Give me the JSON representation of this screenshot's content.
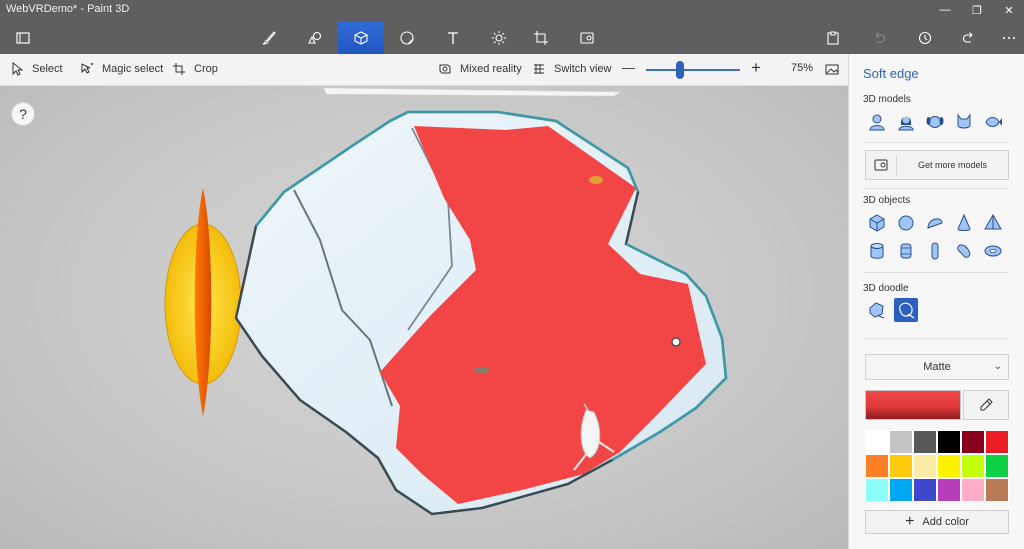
{
  "window": {
    "title": "WebVRDemo* - Paint 3D",
    "controls": [
      "—",
      "❐",
      "✕"
    ]
  },
  "toolbar": {
    "tools": [
      {
        "name": "menu",
        "icon": "folder-icon"
      },
      {
        "name": "brushes",
        "icon": "brush-icon"
      },
      {
        "name": "2d-shapes",
        "icon": "shapes-2d-icon"
      },
      {
        "name": "3d-shapes",
        "icon": "cube-icon",
        "active": true
      },
      {
        "name": "stickers",
        "icon": "sticker-icon"
      },
      {
        "name": "text",
        "icon": "text-icon"
      },
      {
        "name": "effects",
        "icon": "sun-icon"
      },
      {
        "name": "canvas",
        "icon": "canvas-crop-icon"
      },
      {
        "name": "remix3d",
        "icon": "remix-icon"
      }
    ],
    "right": [
      "paste-icon",
      "undo-icon",
      "history-icon",
      "redo-icon",
      "more-icon"
    ]
  },
  "subbar": {
    "select": "Select",
    "magic_select": "Magic select",
    "crop": "Crop",
    "mixed_reality": "Mixed reality",
    "switch_view": "Switch view",
    "zoom_minus": "—",
    "zoom_plus": "+",
    "zoom_level": "75%"
  },
  "canvas": {
    "help": "?"
  },
  "panel": {
    "title": "Soft edge",
    "section_models": "3D models",
    "models": [
      "man-model-icon",
      "woman-model-icon",
      "dog-model-icon",
      "cat-model-icon",
      "fish-model-icon"
    ],
    "get_more": "Get more models",
    "section_objects": "3D objects",
    "objects_row1": [
      "cube-icon",
      "sphere-icon",
      "hemisphere-icon",
      "cone-icon",
      "pyramid-icon"
    ],
    "objects_row2": [
      "cylinder-icon",
      "tube-icon",
      "capsule-icon",
      "bean-icon",
      "donut-icon"
    ],
    "section_doodle": "3D doodle",
    "doodles": [
      "sharp-edge-icon",
      "soft-edge-icon"
    ],
    "material": "Matte",
    "current_color": "#ef4646",
    "palette": [
      "#ffffff",
      "#c3c3c3",
      "#585858",
      "#000000",
      "#88001b",
      "#ec1c24",
      "#ff7f27",
      "#ffc90e",
      "#fdeca6",
      "#fff200",
      "#c4ff0e",
      "#0ed145",
      "#8cfffb",
      "#00a8f3",
      "#3f48cc",
      "#b83dba",
      "#ffaec8",
      "#b97a56"
    ],
    "add_color": "Add color"
  }
}
